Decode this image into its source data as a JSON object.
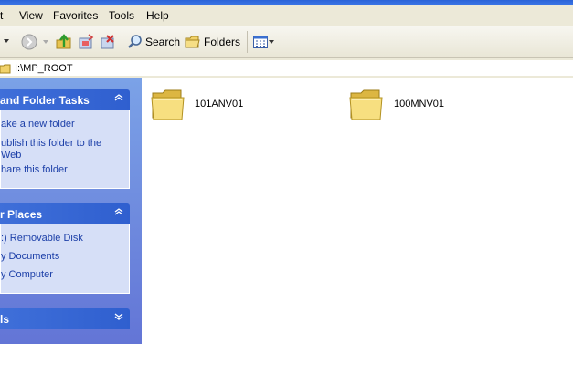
{
  "menubar": {
    "items": [
      "t",
      "View",
      "Favorites",
      "Tools",
      "Help"
    ]
  },
  "toolbar": {
    "search_label": "Search",
    "folders_label": "Folders"
  },
  "address": {
    "path": "I:\\MP_ROOT"
  },
  "taskpane": {
    "file_tasks": {
      "title": "and Folder Tasks",
      "items": [
        "ake a new folder",
        "ublish this folder to the Web",
        "hare this folder"
      ]
    },
    "other_places": {
      "title": "r Places",
      "items": [
        ":) Removable Disk",
        "y Documents",
        "y Computer"
      ]
    },
    "details": {
      "title": "ls"
    }
  },
  "folders": [
    {
      "name": "101ANV01"
    },
    {
      "name": "100MNV01"
    }
  ],
  "colors": {
    "taskpane_bg": "#6f8fdf",
    "panel_header": "#2f5fcf",
    "panel_body": "#d6dff7",
    "link_text": "#1c3fa8",
    "folder_yellow": "#f5d768"
  }
}
